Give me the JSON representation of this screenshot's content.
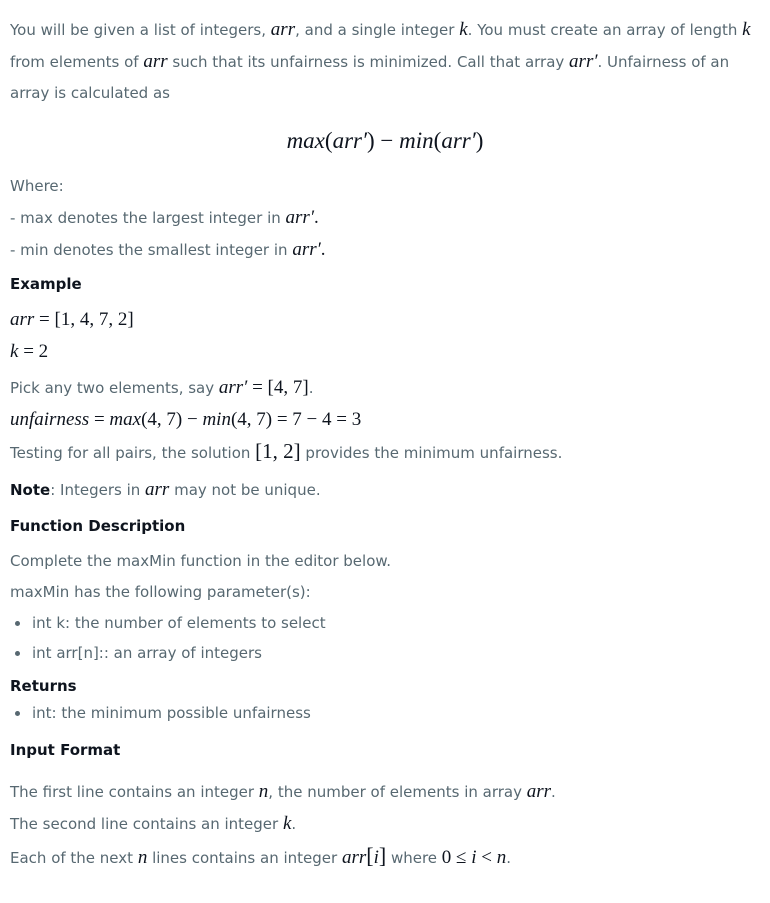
{
  "intro": {
    "t1": "You will be given a list of integers, ",
    "var_arr": "arr",
    "t2": ", and a single integer ",
    "var_k": "k",
    "t3": ". You must create an array of length ",
    "t4": " from elements of ",
    "t5": " such that its unfairness is minimized. Call that array ",
    "var_arr_prime": "arr′",
    "t6": ". Unfairness of an array is calculated as"
  },
  "formula": {
    "f1": "max",
    "f2": "(",
    "f3": "arr′",
    "f4": ") − ",
    "f5": "min",
    "f6": "(",
    "f7": "arr′",
    "f8": ")"
  },
  "where": {
    "label": "Where:",
    "max_line": "- max denotes the largest integer in ",
    "min_line": "- min denotes the smallest integer in ",
    "var": "arr′",
    "dot": "."
  },
  "example": {
    "heading": "Example",
    "arr_var": "arr",
    "arr_eq": " = [1, 4, 7, 2]",
    "k_var": "k",
    "k_eq": " = 2",
    "pick_text": "Pick any two elements, say ",
    "pick_var": "arr′",
    "pick_eq": " = [4, 7]",
    "pick_end": ".",
    "unf_var": "unfairness",
    "unf_eq1": " = ",
    "unf_max": "max",
    "unf_eq2": "(4, 7) − ",
    "unf_min": "min",
    "unf_eq3": "(4, 7) = 7 − 4 = 3",
    "testing_1": "Testing for all pairs, the solution ",
    "testing_sol": "[1, 2]",
    "testing_2": " provides the minimum unfairness."
  },
  "note": {
    "label": "Note",
    "t1": ": Integers in ",
    "var": "arr",
    "t2": " may not be unique."
  },
  "function_description": {
    "heading": "Function Description",
    "line1": "Complete the maxMin function in the editor below.",
    "line2": "maxMin has the following parameter(s):",
    "params": [
      "int k: the number of elements to select",
      "int arr[n]:: an array of integers"
    ]
  },
  "returns": {
    "heading": "Returns",
    "items": [
      "int: the minimum possible unfairness"
    ]
  },
  "input_format": {
    "heading": "Input Format",
    "l1_a": "The first line contains an integer ",
    "l1_var": "n",
    "l1_b": ", the number of elements in array ",
    "l1_var2": "arr",
    "l1_c": ".",
    "l2_a": "The second line contains an integer ",
    "l2_var": "k",
    "l2_b": ".",
    "l3_a": "Each of the next ",
    "l3_var": "n",
    "l3_b": " lines contains an integer ",
    "l3_var2": "arr",
    "l3_idx": "[",
    "l3_i": "i",
    "l3_idx2": "]",
    "l3_c": " where ",
    "l3_zero": "0 ≤ ",
    "l3_i2": "i",
    "l3_lt": " < ",
    "l3_n": "n",
    "l3_end": "."
  }
}
